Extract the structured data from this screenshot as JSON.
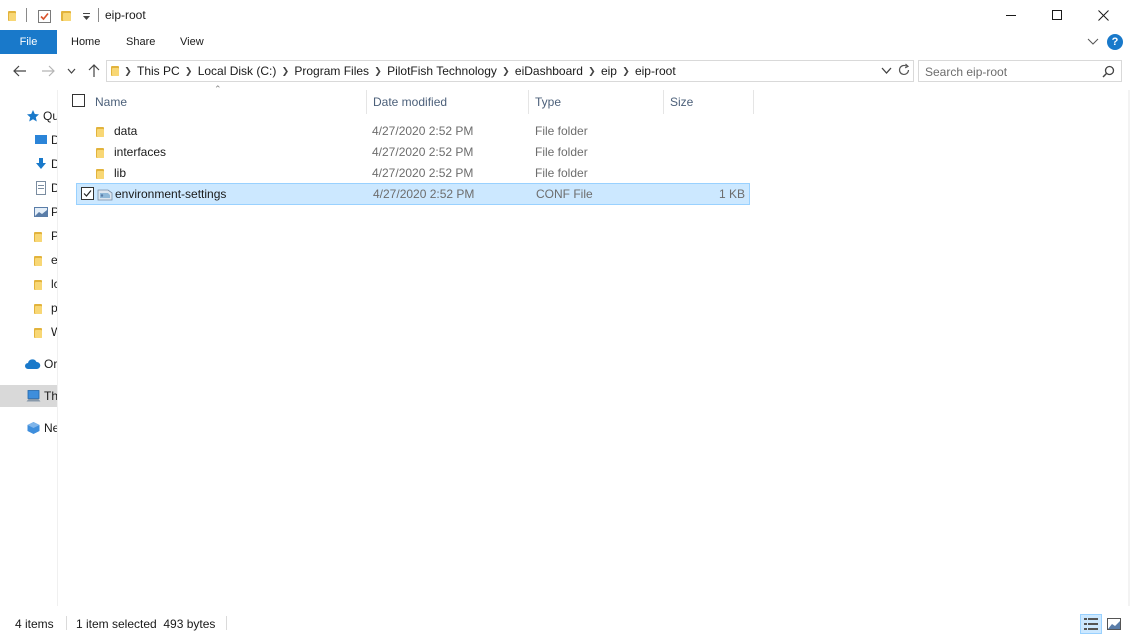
{
  "window": {
    "title": "eip-root"
  },
  "ribbon": {
    "file": "File",
    "tabs": [
      "Home",
      "Share",
      "View"
    ],
    "help": "?"
  },
  "address": {
    "crumbs": [
      "This PC",
      "Local Disk (C:)",
      "Program Files",
      "PilotFish Technology",
      "eiDashboard",
      "eip",
      "eip-root"
    ]
  },
  "search": {
    "placeholder": "Search eip-root"
  },
  "nav_pane": {
    "items": [
      {
        "label": "Qu",
        "icon": "star-icon"
      },
      {
        "label": "D",
        "icon": "desktop-icon"
      },
      {
        "label": "D",
        "icon": "downloads-icon"
      },
      {
        "label": "D",
        "icon": "documents-icon"
      },
      {
        "label": "P",
        "icon": "pictures-icon"
      },
      {
        "label": "P",
        "icon": "folder-icon"
      },
      {
        "label": "e",
        "icon": "folder-icon"
      },
      {
        "label": "lc",
        "icon": "folder-icon"
      },
      {
        "label": "p",
        "icon": "folder-icon"
      },
      {
        "label": "W",
        "icon": "folder-icon"
      },
      {
        "label": "Or",
        "icon": "cloud-icon"
      },
      {
        "label": "Th",
        "icon": "pc-icon"
      },
      {
        "label": "Ne",
        "icon": "network-icon"
      }
    ]
  },
  "columns": {
    "name": "Name",
    "date": "Date modified",
    "type": "Type",
    "size": "Size"
  },
  "files": [
    {
      "name": "data",
      "date": "4/27/2020 2:52 PM",
      "type": "File folder",
      "size": "",
      "icon": "folder-icon",
      "selected": false
    },
    {
      "name": "interfaces",
      "date": "4/27/2020 2:52 PM",
      "type": "File folder",
      "size": "",
      "icon": "folder-icon",
      "selected": false
    },
    {
      "name": "lib",
      "date": "4/27/2020 2:52 PM",
      "type": "File folder",
      "size": "",
      "icon": "folder-icon",
      "selected": false
    },
    {
      "name": "environment-settings",
      "date": "4/27/2020 2:52 PM",
      "type": "CONF File",
      "size": "1 KB",
      "icon": "conf-file-icon",
      "selected": true
    }
  ],
  "status": {
    "count": "4 items",
    "selection": "1 item selected  493 bytes"
  },
  "colors": {
    "accent": "#1979ca",
    "selection_bg": "#cce8ff",
    "selection_border": "#99d1ff",
    "folder": "#f8d775"
  }
}
